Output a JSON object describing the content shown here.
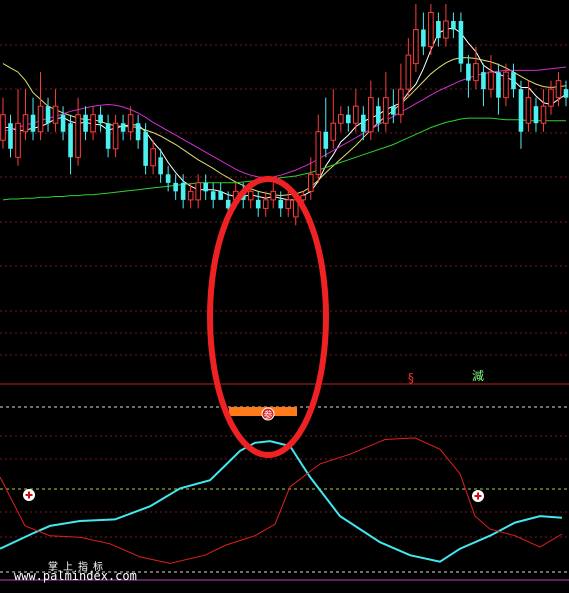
{
  "labels": {
    "signal_s": "§",
    "signal_reduce": "減",
    "signal_join": "参",
    "brand": "掌上指标",
    "watermark": "www.palmindex.com"
  },
  "chart_data": [
    {
      "type": "candlestick",
      "title": "",
      "xlabel": "",
      "ylabel": "",
      "grid": true,
      "ylim": [
        1,
        32
      ],
      "candles": [
        {
          "o": 16,
          "c": 19,
          "h": 21,
          "l": 15
        },
        {
          "o": 18,
          "c": 15,
          "h": 19,
          "l": 14
        },
        {
          "o": 14,
          "c": 18,
          "h": 22,
          "l": 13
        },
        {
          "o": 17,
          "c": 19,
          "h": 22,
          "l": 16
        },
        {
          "o": 19,
          "c": 17,
          "h": 21,
          "l": 16
        },
        {
          "o": 17,
          "c": 20,
          "h": 24,
          "l": 16
        },
        {
          "o": 20,
          "c": 18,
          "h": 21,
          "l": 17
        },
        {
          "o": 18,
          "c": 20,
          "h": 22,
          "l": 17
        },
        {
          "o": 19,
          "c": 17,
          "h": 20,
          "l": 16
        },
        {
          "o": 18,
          "c": 14,
          "h": 19,
          "l": 12
        },
        {
          "o": 14,
          "c": 19,
          "h": 21,
          "l": 13
        },
        {
          "o": 19,
          "c": 17,
          "h": 20,
          "l": 16
        },
        {
          "o": 17,
          "c": 19,
          "h": 20,
          "l": 16
        },
        {
          "o": 19,
          "c": 18,
          "h": 20,
          "l": 17
        },
        {
          "o": 18,
          "c": 15,
          "h": 19,
          "l": 14
        },
        {
          "o": 15,
          "c": 18,
          "h": 19,
          "l": 14
        },
        {
          "o": 18,
          "c": 17,
          "h": 19,
          "l": 16
        },
        {
          "o": 17,
          "c": 19,
          "h": 20,
          "l": 16
        },
        {
          "o": 18,
          "c": 16,
          "h": 19,
          "l": 15
        },
        {
          "o": 17,
          "c": 13,
          "h": 18,
          "l": 12
        },
        {
          "o": 13,
          "c": 15,
          "h": 16,
          "l": 12
        },
        {
          "o": 14,
          "c": 12,
          "h": 15,
          "l": 11
        },
        {
          "o": 12,
          "c": 11,
          "h": 13,
          "l": 10
        },
        {
          "o": 11,
          "c": 10,
          "h": 12,
          "l": 9
        },
        {
          "o": 11,
          "c": 9,
          "h": 12,
          "l": 8
        },
        {
          "o": 9,
          "c": 10,
          "h": 11,
          "l": 8
        },
        {
          "o": 9,
          "c": 11,
          "h": 12,
          "l": 8
        },
        {
          "o": 11,
          "c": 10,
          "h": 12,
          "l": 9
        },
        {
          "o": 10,
          "c": 9,
          "h": 11,
          "l": 8
        },
        {
          "o": 10,
          "c": 9,
          "h": 11,
          "l": 9
        },
        {
          "o": 9,
          "c": 8,
          "h": 10,
          "l": 7
        },
        {
          "o": 9,
          "c": 10,
          "h": 11,
          "l": 8
        },
        {
          "o": 10,
          "c": 9,
          "h": 11,
          "l": 8
        },
        {
          "o": 9,
          "c": 10,
          "h": 11,
          "l": 8
        },
        {
          "o": 9,
          "c": 8,
          "h": 10,
          "l": 7
        },
        {
          "o": 8,
          "c": 9,
          "h": 10,
          "l": 7
        },
        {
          "o": 9,
          "c": 10,
          "h": 11,
          "l": 8
        },
        {
          "o": 9,
          "c": 8,
          "h": 10,
          "l": 7
        },
        {
          "o": 8,
          "c": 9,
          "h": 10,
          "l": 7
        },
        {
          "o": 7,
          "c": 9,
          "h": 10,
          "l": 6
        },
        {
          "o": 9,
          "c": 9.5,
          "h": 10,
          "l": 8
        },
        {
          "o": 10,
          "c": 12,
          "h": 14,
          "l": 9
        },
        {
          "o": 12,
          "c": 17,
          "h": 19,
          "l": 11
        },
        {
          "o": 17,
          "c": 15,
          "h": 21,
          "l": 14
        },
        {
          "o": 16,
          "c": 18,
          "h": 22,
          "l": 15
        },
        {
          "o": 18,
          "c": 19,
          "h": 20,
          "l": 17
        },
        {
          "o": 19,
          "c": 18,
          "h": 20,
          "l": 17
        },
        {
          "o": 18,
          "c": 20,
          "h": 22,
          "l": 17
        },
        {
          "o": 19,
          "c": 17,
          "h": 20,
          "l": 16
        },
        {
          "o": 17,
          "c": 21,
          "h": 23,
          "l": 16
        },
        {
          "o": 20,
          "c": 18,
          "h": 21,
          "l": 17
        },
        {
          "o": 18,
          "c": 21,
          "h": 24,
          "l": 17
        },
        {
          "o": 20,
          "c": 19,
          "h": 22,
          "l": 18
        },
        {
          "o": 19,
          "c": 22,
          "h": 25,
          "l": 18
        },
        {
          "o": 22,
          "c": 26,
          "h": 28,
          "l": 21
        },
        {
          "o": 25,
          "c": 29,
          "h": 32,
          "l": 24
        },
        {
          "o": 29,
          "c": 27,
          "h": 31,
          "l": 26
        },
        {
          "o": 27,
          "c": 31,
          "h": 32,
          "l": 26
        },
        {
          "o": 30,
          "c": 28,
          "h": 31,
          "l": 27
        },
        {
          "o": 28,
          "c": 30,
          "h": 32,
          "l": 27
        },
        {
          "o": 30,
          "c": 29,
          "h": 31,
          "l": 28
        },
        {
          "o": 30,
          "c": 25,
          "h": 31,
          "l": 24
        },
        {
          "o": 25,
          "c": 23,
          "h": 26,
          "l": 21
        },
        {
          "o": 23,
          "c": 25,
          "h": 27,
          "l": 22
        },
        {
          "o": 24,
          "c": 22,
          "h": 25,
          "l": 20
        },
        {
          "o": 22,
          "c": 24,
          "h": 26,
          "l": 21
        },
        {
          "o": 24,
          "c": 21,
          "h": 25,
          "l": 19
        },
        {
          "o": 21,
          "c": 24,
          "h": 25,
          "l": 20
        },
        {
          "o": 24,
          "c": 22,
          "h": 25,
          "l": 21
        },
        {
          "o": 22,
          "c": 17,
          "h": 23,
          "l": 15
        },
        {
          "o": 18,
          "c": 21,
          "h": 23,
          "l": 17
        },
        {
          "o": 20,
          "c": 18,
          "h": 21,
          "l": 17
        },
        {
          "o": 18,
          "c": 20,
          "h": 22,
          "l": 17
        },
        {
          "o": 20,
          "c": 22,
          "h": 23,
          "l": 19
        },
        {
          "o": 21,
          "c": 23,
          "h": 24,
          "l": 20
        },
        {
          "o": 22,
          "c": 21,
          "h": 23,
          "l": 20
        }
      ],
      "series": [
        {
          "color": "#ffffff",
          "values": [
            17.5,
            17.5,
            17.1,
            17.2,
            17.4,
            17.6,
            18.0,
            18.5,
            18.7,
            18.2,
            18.0,
            18.1,
            17.9,
            17.8,
            17.2,
            17.4,
            17.7,
            17.8,
            17.8,
            17.0,
            15.8,
            14.8,
            13.4,
            12.2,
            11.2,
            10.6,
            10.2,
            10.2,
            10.2,
            10.0,
            9.6,
            9.4,
            9.4,
            9.6,
            9.4,
            9.2,
            9.4,
            9.2,
            9.0,
            9.0,
            9.5,
            10.0,
            11.2,
            13.0,
            14.3,
            15.8,
            16.6,
            17.6,
            18.2,
            18.6,
            19.0,
            19.6,
            20.0,
            20.4,
            21.6,
            22.6,
            24.4,
            26.6,
            28.6,
            29.0,
            29.2,
            28.6,
            27.4,
            26.4,
            24.8,
            24.2,
            23.8,
            23.4,
            23.0,
            22.2,
            22.2,
            21.2,
            20.4,
            20.2,
            20.8,
            21.4
          ]
        },
        {
          "color": "#e0e070",
          "values": [
            25,
            24.5,
            24,
            23,
            21.6,
            20.8,
            20,
            19.6,
            19.2,
            18.9,
            18.6,
            18.4,
            18.4,
            18.2,
            17.9,
            17.7,
            17.6,
            17.6,
            17.5,
            17.2,
            16.9,
            16.5,
            16.0,
            15.5,
            14.9,
            14.3,
            13.7,
            13.2,
            12.7,
            12.1,
            11.6,
            11.1,
            10.7,
            10.3,
            10.0,
            9.8,
            9.6,
            9.5,
            9.6,
            9.7,
            10.0,
            10.5,
            11.3,
            12.2,
            13.0,
            13.8,
            14.6,
            15.4,
            16.3,
            17.2,
            18.1,
            18.8,
            19.5,
            20.3,
            21.1,
            22.0,
            22.9,
            23.8,
            24.5,
            25.1,
            25.5,
            25.7,
            25.7,
            25.6,
            25.4,
            25.2,
            24.9,
            24.5,
            24.0,
            23.5,
            23.0,
            22.6,
            22.3,
            22.2,
            22.3,
            22.4
          ]
        },
        {
          "color": "#d030d0",
          "values": [
            17.0,
            17.3,
            17.5,
            17.8,
            18.0,
            18.3,
            18.6,
            18.8,
            19.1,
            19.4,
            19.6,
            19.8,
            20.0,
            20.1,
            20.2,
            20.1,
            19.9,
            19.6,
            19.2,
            18.7,
            18.1,
            17.6,
            17.1,
            16.6,
            16.1,
            15.6,
            15.1,
            14.6,
            14.1,
            13.6,
            13.1,
            12.6,
            12.2,
            11.9,
            11.7,
            11.6,
            11.7,
            11.9,
            12.2,
            12.5,
            12.9,
            13.3,
            13.8,
            14.3,
            14.8,
            15.3,
            15.8,
            16.3,
            16.8,
            17.3,
            17.8,
            18.3,
            18.8,
            19.3,
            19.8,
            20.3,
            20.8,
            21.3,
            21.8,
            22.2,
            22.6,
            23.0,
            23.3,
            23.6,
            23.8,
            24.0,
            24.1,
            24.2,
            24.2,
            24.2,
            24.2,
            24.2,
            24.3,
            24.4,
            24.5,
            24.6
          ]
        },
        {
          "color": "#30d030",
          "values": [
            9.0,
            9.1,
            9.1,
            9.2,
            9.2,
            9.3,
            9.3,
            9.4,
            9.4,
            9.5,
            9.5,
            9.6,
            9.6,
            9.7,
            9.8,
            9.9,
            10.0,
            10.1,
            10.2,
            10.3,
            10.4,
            10.5,
            10.6,
            10.7,
            10.8,
            10.9,
            11.0,
            11.0,
            11.0,
            11.0,
            11.0,
            11.0,
            11.1,
            11.2,
            11.3,
            11.4,
            11.5,
            11.6,
            11.7,
            11.8,
            12.0,
            12.2,
            12.5,
            12.8,
            13.1,
            13.4,
            13.7,
            14.0,
            14.3,
            14.6,
            14.9,
            15.2,
            15.5,
            15.9,
            16.3,
            16.7,
            17.1,
            17.5,
            17.8,
            18.1,
            18.3,
            18.5,
            18.6,
            18.6,
            18.6,
            18.6,
            18.5,
            18.4,
            18.4,
            18.4,
            18.3,
            18.3,
            18.3,
            18.3,
            18.3,
            18.3
          ]
        }
      ]
    },
    {
      "type": "line",
      "title": "",
      "xlabel": "",
      "ylabel": "",
      "grid": true,
      "ylim": [
        0,
        100
      ],
      "series": [
        {
          "color": "#40e8f0",
          "values": [
            [
              0,
              10
            ],
            [
              35,
              20
            ],
            [
              50,
              24
            ],
            [
              80,
              27
            ],
            [
              115,
              28
            ],
            [
              150,
              36
            ],
            [
              180,
              47
            ],
            [
              210,
              52
            ],
            [
              225,
              61
            ],
            [
              240,
              70
            ],
            [
              255,
              75
            ],
            [
              270,
              76
            ],
            [
              290,
              73
            ],
            [
              310,
              54
            ],
            [
              340,
              30
            ],
            [
              380,
              14
            ],
            [
              410,
              6
            ],
            [
              440,
              2
            ],
            [
              460,
              10
            ],
            [
              490,
              18
            ],
            [
              515,
              26
            ],
            [
              540,
              30
            ],
            [
              562,
              29
            ]
          ]
        },
        {
          "color": "#e02020",
          "values": [
            [
              0,
              54
            ],
            [
              25,
              24
            ],
            [
              50,
              18
            ],
            [
              80,
              17
            ],
            [
              110,
              13
            ],
            [
              140,
              5
            ],
            [
              170,
              1
            ],
            [
              205,
              6
            ],
            [
              225,
              12
            ],
            [
              255,
              18
            ],
            [
              275,
              25
            ],
            [
              290,
              48
            ],
            [
              320,
              62
            ],
            [
              350,
              68
            ],
            [
              385,
              77
            ],
            [
              415,
              78
            ],
            [
              440,
              71
            ],
            [
              460,
              56
            ],
            [
              475,
              30
            ],
            [
              490,
              22
            ],
            [
              515,
              18
            ],
            [
              540,
              11
            ],
            [
              562,
              19
            ]
          ]
        }
      ]
    }
  ]
}
